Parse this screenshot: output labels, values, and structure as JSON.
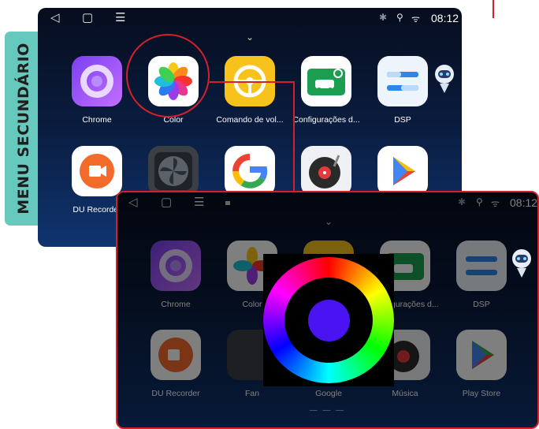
{
  "side_label": "MENU SECUNDÁRIO",
  "status": {
    "back": "◁",
    "home": "▢",
    "menu": "☰",
    "time": "08:12",
    "bt": "✱",
    "loc": "⚲",
    "wifi": "ᯤ",
    "chevron": "⌄"
  },
  "screen1": {
    "row1": [
      {
        "label": "Chrome",
        "icon": "chrome-icon"
      },
      {
        "label": "Color",
        "icon": "color-petals-icon"
      },
      {
        "label": "Comando de vol...",
        "icon": "steering-wheel-icon"
      },
      {
        "label": "Configurações d...",
        "icon": "car-settings-icon"
      },
      {
        "label": "DSP",
        "icon": "dsp-sliders-icon"
      }
    ],
    "row2": [
      {
        "label": "DU Recorder",
        "icon": "du-recorder-icon"
      },
      {
        "label": "",
        "icon": "fan-icon"
      },
      {
        "label": "",
        "icon": "google-icon"
      },
      {
        "label": "",
        "icon": "music-vinyl-icon"
      },
      {
        "label": "",
        "icon": "play-store-icon"
      }
    ]
  },
  "screen2": {
    "row1": [
      {
        "label": "Chrome",
        "icon": "chrome-icon"
      },
      {
        "label": "Color",
        "icon": "color-petals-icon"
      },
      {
        "label": "",
        "icon": "steering-wheel-icon"
      },
      {
        "label": "Configurações d...",
        "icon": "car-settings-icon"
      },
      {
        "label": "DSP",
        "icon": "dsp-sliders-icon"
      }
    ],
    "row2": [
      {
        "label": "DU Recorder",
        "icon": "du-recorder-icon"
      },
      {
        "label": "Fan",
        "icon": "fan-icon"
      },
      {
        "label": "Google",
        "icon": "google-icon"
      },
      {
        "label": "Música",
        "icon": "music-vinyl-icon"
      },
      {
        "label": "Play Store",
        "icon": "play-store-icon"
      }
    ],
    "pager": "— — —"
  },
  "colors": {
    "accent": "#d4202a",
    "teal": "#67c8bd",
    "picker_center": "#4a14f2"
  }
}
